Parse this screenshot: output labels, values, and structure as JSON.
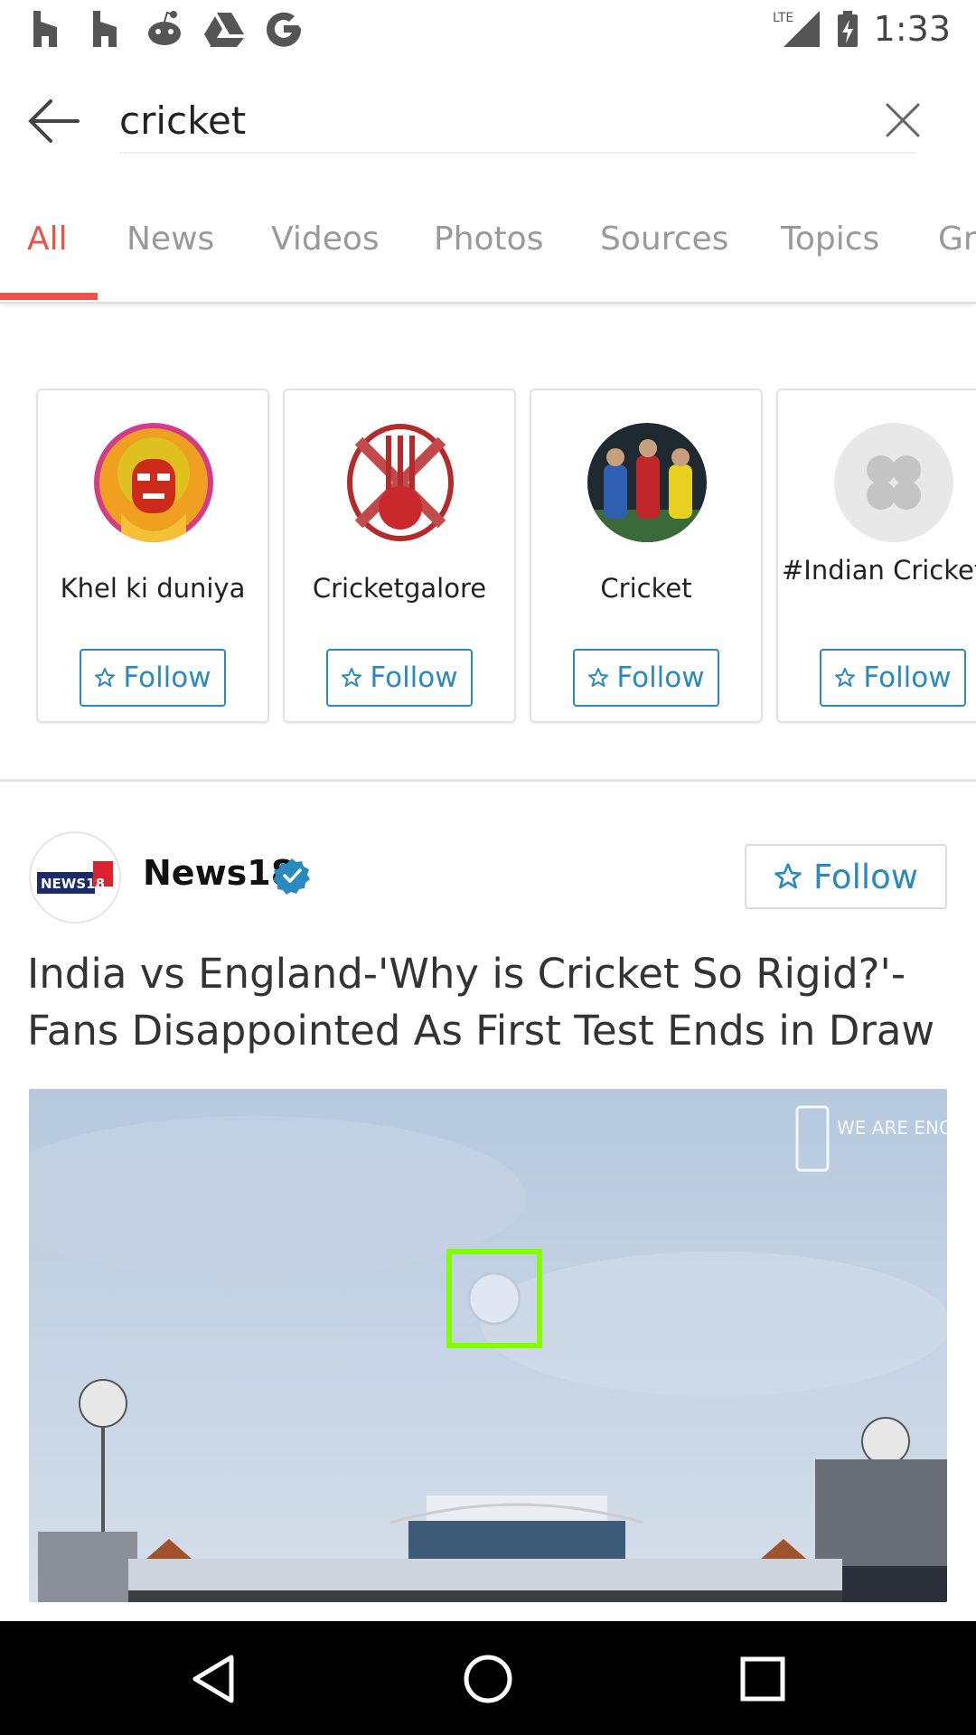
{
  "status_bar": {
    "notification_icons": [
      "houzz-icon",
      "houzz-icon",
      "reddit-icon",
      "google-drive-icon",
      "google-icon"
    ],
    "network": "LTE",
    "time": "1:33"
  },
  "search": {
    "query": "cricket"
  },
  "tabs": [
    {
      "label": "All",
      "active": true
    },
    {
      "label": "News",
      "active": false
    },
    {
      "label": "Videos",
      "active": false
    },
    {
      "label": "Photos",
      "active": false
    },
    {
      "label": "Sources",
      "active": false
    },
    {
      "label": "Topics",
      "active": false
    },
    {
      "label": "Gr",
      "active": false
    }
  ],
  "sources": [
    {
      "name": "Khel ki duniya",
      "follow_label": "Follow"
    },
    {
      "name": "Cricketgalore",
      "follow_label": "Follow"
    },
    {
      "name": "Cricket",
      "follow_label": "Follow"
    },
    {
      "name": "#Indian Cricket J",
      "follow_label": "Follow"
    }
  ],
  "article": {
    "publisher": "News18",
    "publisher_logo_text": "NEWS18",
    "follow_label": "Follow",
    "headline": "India vs England-'Why is Cricket So Rigid?'-Fans Disappointed As First Test Ends in Draw",
    "image_watermark": "WE ARE ENGLAND CRICKET"
  },
  "colors": {
    "accent": "#e8534a",
    "follow_blue": "#2a8ac0",
    "tab_inactive": "#999999"
  }
}
